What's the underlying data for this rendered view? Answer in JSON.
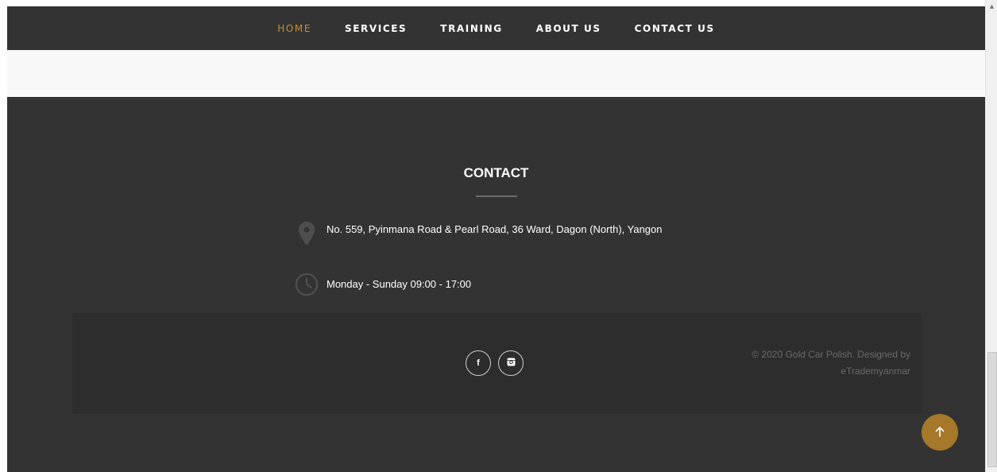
{
  "nav": {
    "items": [
      {
        "label": "HOME",
        "active": true
      },
      {
        "label": "SERVICES"
      },
      {
        "label": "TRAINING"
      },
      {
        "label": "ABOUT US"
      },
      {
        "label": "CONTACT US"
      }
    ]
  },
  "contact": {
    "title": "CONTACT",
    "address": "No. 559, Pyinmana Road & Pearl Road, 36 Ward, Dagon (North), Yangon",
    "hours": "Monday - Sunday  09:00 - 17:00",
    "address_icon": "map-pin-icon",
    "hours_icon": "clock-icon"
  },
  "footer": {
    "social": [
      {
        "label": "f",
        "icon": "facebook-icon"
      },
      {
        "label": "",
        "icon": "instagram-icon"
      }
    ],
    "copyright": "© 2020 Gold Car Polish.  Designed by",
    "designer": "eTrademyanmar"
  },
  "colors": {
    "dark_bg": "#333333",
    "accent": "#c8912f",
    "to_top": "#a5782a"
  }
}
